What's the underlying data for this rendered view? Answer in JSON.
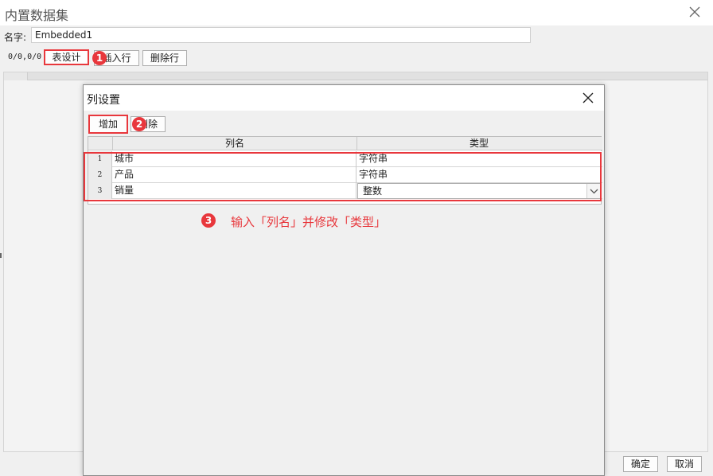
{
  "window": {
    "title": "内置数据集",
    "close_icon": "close-icon"
  },
  "name_field": {
    "label": "名字:",
    "value": "Embedded1"
  },
  "toolbar": {
    "position_readout": "0/0,0/0",
    "table_design_label": "表设计",
    "insert_row_label": "插入行",
    "delete_row_label": "删除行"
  },
  "footer": {
    "confirm_label": "确定",
    "cancel_label": "取消"
  },
  "dialog": {
    "title": "列设置",
    "add_label": "增加",
    "delete_label": "删除",
    "columns": [
      "列名",
      "类型"
    ],
    "rows": [
      {
        "index": "1",
        "name": "城市",
        "type": "字符串"
      },
      {
        "index": "2",
        "name": "产品",
        "type": "字符串"
      },
      {
        "index": "3",
        "name": "销量",
        "type": "整数"
      }
    ]
  },
  "annotations": {
    "step1": "1",
    "step2": "2",
    "step3": "3",
    "step3_text": "输入「列名」并修改「类型」"
  },
  "colors": {
    "highlight": "#e8373c",
    "panel": "#f0f0f0"
  }
}
